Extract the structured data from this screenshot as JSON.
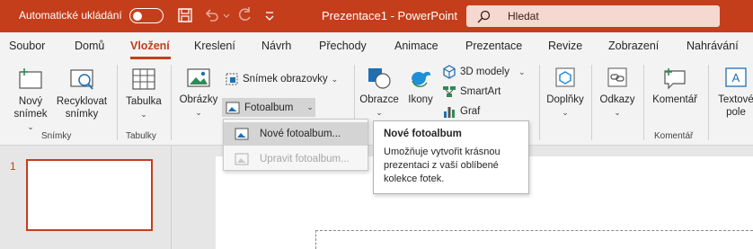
{
  "titlebar": {
    "autosave_label": "Automatické ukládání",
    "doc_title": "Prezentace1  -  PowerPoint",
    "search_label": "Hledat",
    "accent": "#c43e1c"
  },
  "tabs": [
    {
      "label": "Soubor"
    },
    {
      "label": "Domů"
    },
    {
      "label": "Vložení"
    },
    {
      "label": "Kreslení"
    },
    {
      "label": "Návrh"
    },
    {
      "label": "Přechody"
    },
    {
      "label": "Animace"
    },
    {
      "label": "Prezentace"
    },
    {
      "label": "Revize"
    },
    {
      "label": "Zobrazení"
    },
    {
      "label": "Nahrávání"
    }
  ],
  "ribbon": {
    "new_slide": {
      "line1": "Nový",
      "line2": "snímek"
    },
    "reuse_slides": {
      "line1": "Recyklovat",
      "line2": "snímky"
    },
    "table": {
      "line1": "Tabulka"
    },
    "images": {
      "line1": "Obrázky"
    },
    "screenshot": {
      "label": "Snímek obrazovky"
    },
    "photo_album": {
      "label": "Fotoalbum"
    },
    "shapes": {
      "line1": "Obrazce"
    },
    "icons": {
      "line1": "Ikony"
    },
    "models_3d": {
      "label": "3D modely"
    },
    "smartart": {
      "label": "SmartArt"
    },
    "chart": {
      "label": "Graf"
    },
    "addins": {
      "line1": "Doplňky"
    },
    "links": {
      "line1": "Odkazy"
    },
    "comment": {
      "line1": "Komentář"
    },
    "textbox": {
      "line1": "Textové",
      "line2": "pole"
    },
    "groups": {
      "slides": "Snímky",
      "tables": "Tabulky",
      "comments": "Komentář"
    }
  },
  "dropdown": {
    "new_album": "Nové fotoalbum...",
    "edit_album": "Upravit fotoalbum..."
  },
  "tooltip": {
    "title": "Nové fotoalbum",
    "body": "Umožňuje vytvořit krásnou prezentaci z vaší oblíbené kolekce fotek."
  },
  "slides_pane": {
    "slide_number": "1"
  }
}
